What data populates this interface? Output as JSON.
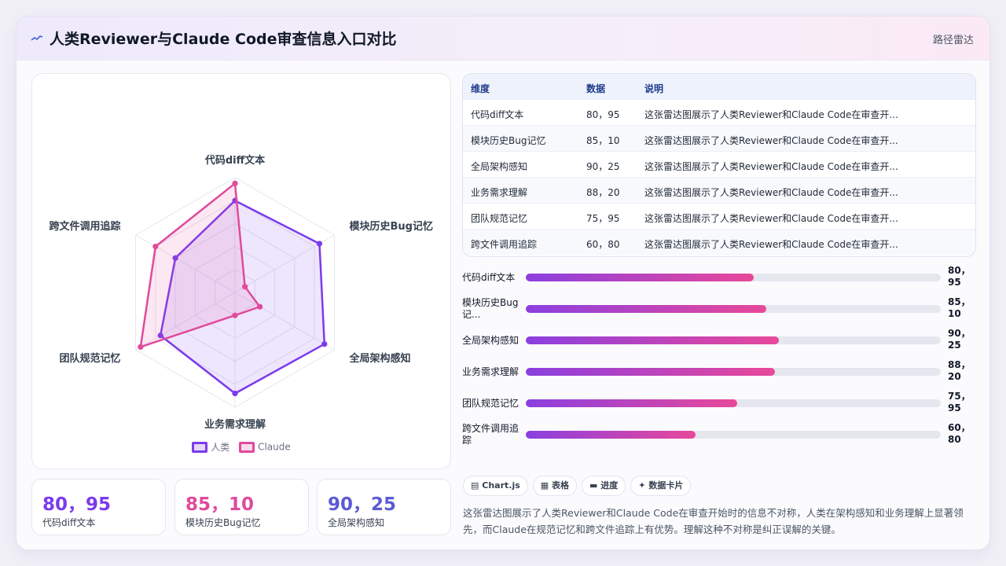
{
  "header": {
    "title": "人类Reviewer与Claude Code审查信息入口对比",
    "right_label": "路径雷达",
    "icon": "wave-icon"
  },
  "chart_data": {
    "type": "radar",
    "axes": [
      "代码diff文本",
      "模块历史Bug记忆",
      "全局架构感知",
      "业务需求理解",
      "团队规范记忆",
      "跨文件调用追踪"
    ],
    "range": [
      0,
      100
    ],
    "series": [
      {
        "name": "人类",
        "color": "#7c3aed",
        "values": [
          80,
          85,
          90,
          88,
          75,
          60
        ]
      },
      {
        "name": "Claude",
        "color": "#e04a9c",
        "values": [
          95,
          10,
          25,
          20,
          95,
          80
        ]
      }
    ]
  },
  "legend": [
    {
      "label": "人类",
      "color": "#7c3aed"
    },
    {
      "label": "Claude",
      "color": "#e04a9c"
    }
  ],
  "stats": [
    {
      "value": "80，95",
      "label": "代码diff文本",
      "color": "#7c3aed"
    },
    {
      "value": "85，10",
      "label": "模块历史Bug记忆",
      "color": "#e04a9c"
    },
    {
      "value": "90，25",
      "label": "全局架构感知",
      "color": "#5b5bd6"
    }
  ],
  "table": {
    "headers": [
      "维度",
      "数据",
      "说明"
    ],
    "rows": [
      [
        "代码diff文本",
        "80，95",
        "这张雷达图展示了人类Reviewer和Claude Code在审查开..."
      ],
      [
        "模块历史Bug记忆",
        "85，10",
        "这张雷达图展示了人类Reviewer和Claude Code在审查开..."
      ],
      [
        "全局架构感知",
        "90，25",
        "这张雷达图展示了人类Reviewer和Claude Code在审查开..."
      ],
      [
        "业务需求理解",
        "88，20",
        "这张雷达图展示了人类Reviewer和Claude Code在审查开..."
      ],
      [
        "团队规范记忆",
        "75，95",
        "这张雷达图展示了人类Reviewer和Claude Code在审查开..."
      ],
      [
        "跨文件调用追踪",
        "60，80",
        "这张雷达图展示了人类Reviewer和Claude Code在审查开..."
      ]
    ]
  },
  "progress": [
    {
      "label": "代码diff文本",
      "value": "80，95",
      "fill": 0.55
    },
    {
      "label": "模块历史Bug记...",
      "value": "85，10",
      "fill": 0.58
    },
    {
      "label": "全局架构感知",
      "value": "90，25",
      "fill": 0.61
    },
    {
      "label": "业务需求理解",
      "value": "88，20",
      "fill": 0.6
    },
    {
      "label": "团队规范记忆",
      "value": "75，95",
      "fill": 0.51
    },
    {
      "label": "跨文件调用追踪",
      "value": "60，80",
      "fill": 0.41
    }
  ],
  "chips": [
    {
      "icon": "chart-icon",
      "glyph": "▤",
      "label": "Chart.js"
    },
    {
      "icon": "table-icon",
      "glyph": "▦",
      "label": "表格"
    },
    {
      "icon": "progress-icon",
      "glyph": "▬",
      "label": "进度"
    },
    {
      "icon": "card-icon",
      "glyph": "✦",
      "label": "数据卡片"
    }
  ],
  "description": "这张雷达图展示了人类Reviewer和Claude Code在审查开始时的信息不对称，人类在架构感知和业务理解上显著领先，而Claude在规范记忆和跨文件追踪上有优势。理解这种不对称是纠正误解的关键。"
}
